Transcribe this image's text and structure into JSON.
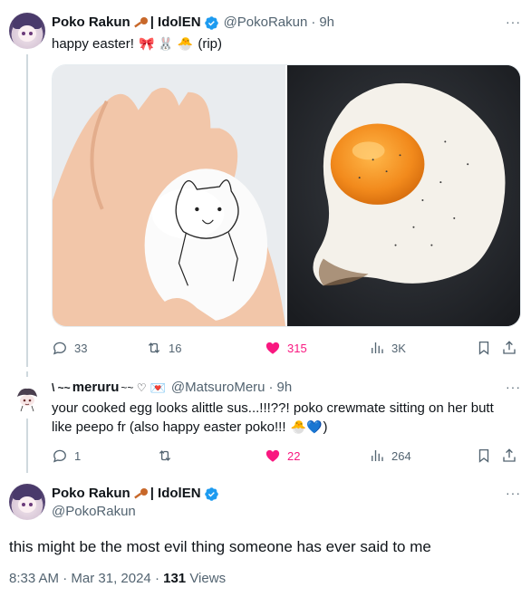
{
  "tweet1": {
    "name": "Poko Rakun",
    "name_suffix": "| IdolEN",
    "handle": "@PokoRakun",
    "dot": "·",
    "time": "9h",
    "text_main": "happy easter!",
    "text_emojis": "🎀 🐰 🐣",
    "text_tail": "(rip)",
    "images": [
      "hand-holding-drawn-egg",
      "fried-egg-in-pan"
    ],
    "stats": {
      "replies": "33",
      "reposts": "16",
      "likes": "315",
      "views": "3K"
    }
  },
  "tweet2": {
    "name": "meruru",
    "name_decor_left": "\\ ~~",
    "name_decor_right": "~~ ♡",
    "envelope": "💌",
    "handle": "@MatsuroMeru",
    "dot": "·",
    "time": "9h",
    "text_line1": "your cooked egg looks alittle sus...!!!??! poko crewmate sitting on her butt",
    "text_line2": "like peepo fr (also happy easter poko!!!",
    "text_emojis": "🐣💙",
    "text_tail": ")",
    "stats": {
      "replies": "1",
      "reposts": "",
      "likes": "22",
      "views": "264"
    }
  },
  "tweet3": {
    "name": "Poko Rakun",
    "name_suffix": "| IdolEN",
    "handle": "@PokoRakun",
    "text": "this might be the most evil thing someone has ever said to me",
    "time": "8:33 AM",
    "dot": "·",
    "date": "Mar 31, 2024",
    "views_count": "131",
    "views_label": "Views"
  },
  "colors": {
    "verified": "#1d9bf0",
    "like": "#f91880",
    "secondary": "#536471",
    "primary": "#0f1419",
    "line": "#cfd9de"
  }
}
